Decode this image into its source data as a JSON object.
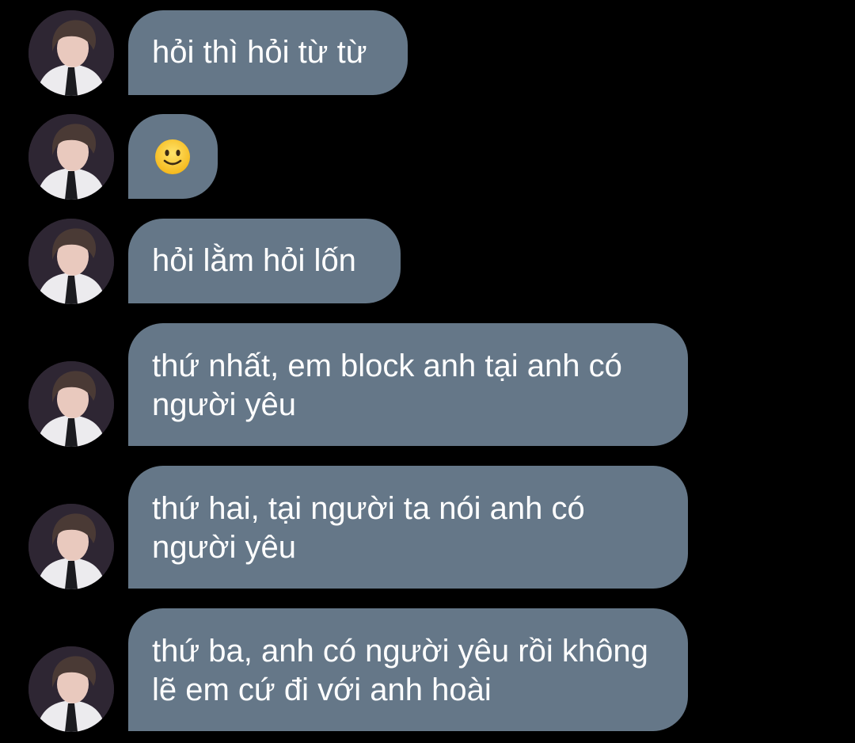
{
  "conversation": {
    "messages": [
      {
        "sender": "avatar",
        "text": "hỏi thì hỏi từ từ"
      },
      {
        "sender": "avatar",
        "emoji": "slightly-smiling-face-icon"
      },
      {
        "sender": "avatar",
        "text": "hỏi lằm hỏi lốn"
      },
      {
        "sender": "avatar",
        "text": "thứ nhất, em block anh tại anh có\nngười yêu"
      },
      {
        "sender": "avatar",
        "text": "thứ hai, tại người ta nói anh có\nngười yêu"
      },
      {
        "sender": "avatar",
        "text": "thứ ba, anh có người yêu rồi không\nlẽ em cứ đi với anh hoài"
      }
    ]
  },
  "colors": {
    "background": "#000000",
    "bubble": "#657788",
    "text": "#ffffff"
  }
}
